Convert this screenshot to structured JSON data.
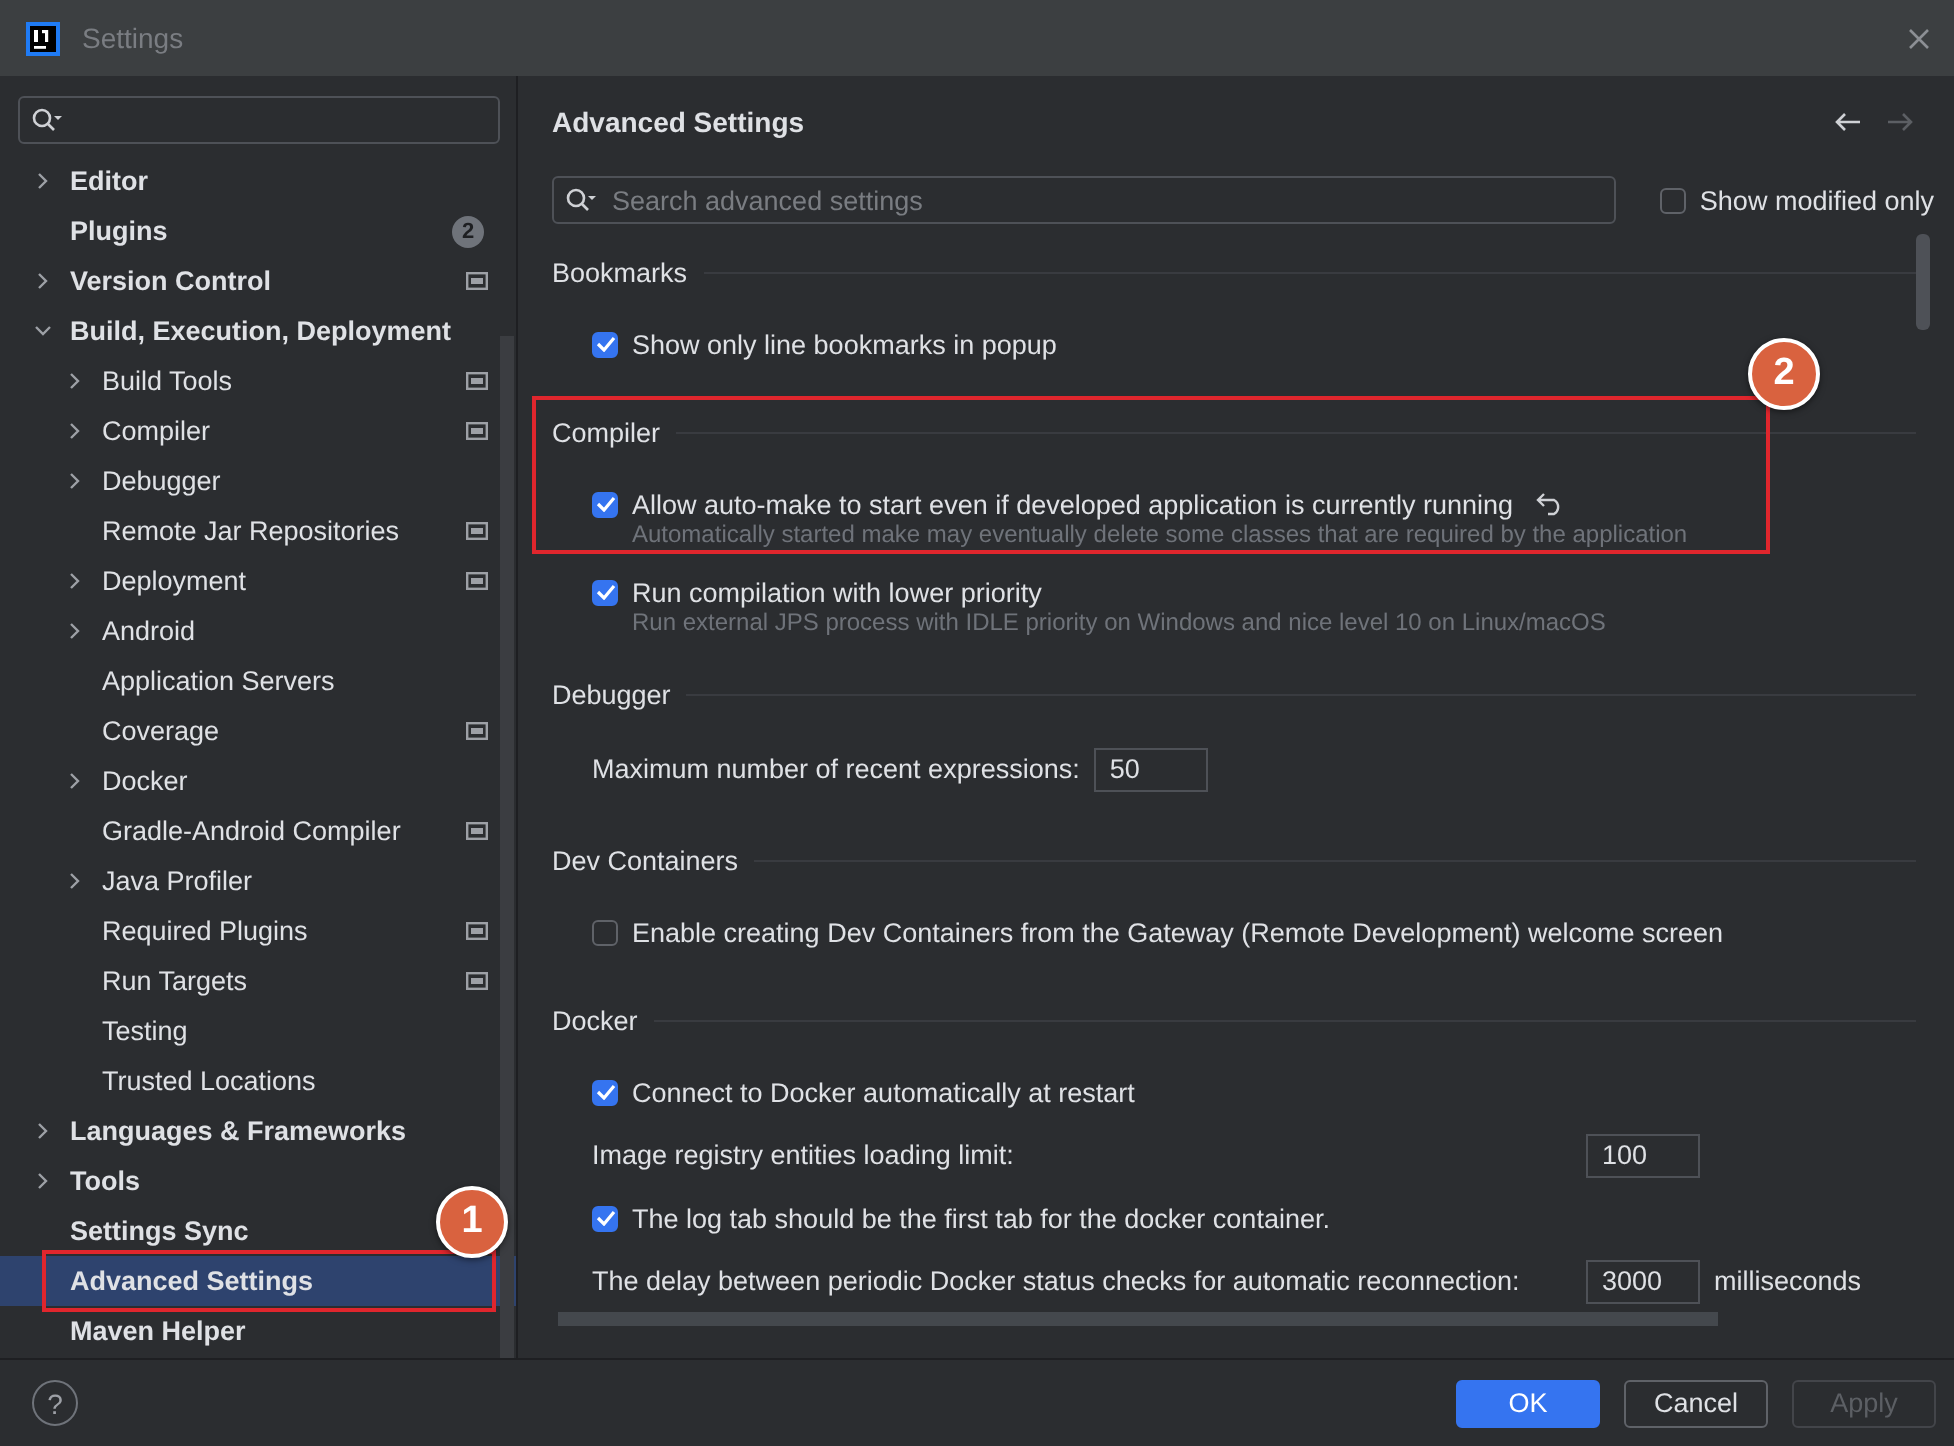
{
  "window": {
    "title": "Settings"
  },
  "sidebar": {
    "items": [
      {
        "label": "Editor",
        "kind": "folder",
        "expanded": false,
        "selected": false
      },
      {
        "label": "Plugins",
        "kind": "page",
        "selected": false,
        "badge": "2"
      },
      {
        "label": "Version Control",
        "kind": "folder",
        "expanded": false,
        "selected": false,
        "project_level": true
      },
      {
        "label": "Build, Execution, Deployment",
        "kind": "folder",
        "expanded": true,
        "selected": false,
        "children": [
          {
            "label": "Build Tools",
            "kind": "folder",
            "expanded": false,
            "selected": false,
            "project_level": true
          },
          {
            "label": "Compiler",
            "kind": "folder",
            "expanded": false,
            "selected": false,
            "project_level": true
          },
          {
            "label": "Debugger",
            "kind": "folder",
            "expanded": false,
            "selected": false
          },
          {
            "label": "Remote Jar Repositories",
            "kind": "page",
            "selected": false,
            "project_level": true
          },
          {
            "label": "Deployment",
            "kind": "folder",
            "expanded": false,
            "selected": false,
            "project_level": true
          },
          {
            "label": "Android",
            "kind": "folder",
            "expanded": false,
            "selected": false
          },
          {
            "label": "Application Servers",
            "kind": "page",
            "selected": false
          },
          {
            "label": "Coverage",
            "kind": "page",
            "selected": false,
            "project_level": true
          },
          {
            "label": "Docker",
            "kind": "folder",
            "expanded": false,
            "selected": false
          },
          {
            "label": "Gradle-Android Compiler",
            "kind": "page",
            "selected": false,
            "project_level": true
          },
          {
            "label": "Java Profiler",
            "kind": "folder",
            "expanded": false,
            "selected": false
          },
          {
            "label": "Required Plugins",
            "kind": "page",
            "selected": false,
            "project_level": true
          },
          {
            "label": "Run Targets",
            "kind": "page",
            "selected": false,
            "project_level": true
          },
          {
            "label": "Testing",
            "kind": "page",
            "selected": false
          },
          {
            "label": "Trusted Locations",
            "kind": "page",
            "selected": false
          }
        ]
      },
      {
        "label": "Languages & Frameworks",
        "kind": "folder",
        "expanded": false,
        "selected": false
      },
      {
        "label": "Tools",
        "kind": "folder",
        "expanded": false,
        "selected": false
      },
      {
        "label": "Settings Sync",
        "kind": "page",
        "selected": false
      },
      {
        "label": "Advanced Settings",
        "kind": "page",
        "selected": true,
        "callout": "1"
      },
      {
        "label": "Maven Helper",
        "kind": "page",
        "selected": false
      }
    ]
  },
  "content": {
    "title": "Advanced Settings",
    "search": {
      "placeholder": "Search advanced settings"
    },
    "show_modified_only": {
      "label": "Show modified only",
      "checked": false
    },
    "sections": [
      {
        "title": "Bookmarks",
        "items": [
          {
            "kind": "checkbox",
            "label": "Show only line bookmarks in popup",
            "checked": true
          }
        ]
      },
      {
        "title": "Compiler",
        "callout": "2",
        "items": [
          {
            "kind": "checkbox",
            "label": "Allow auto-make to start even if developed application is currently running",
            "checked": true,
            "modified": true,
            "description": "Automatically started make may eventually delete some classes that are required by the application"
          },
          {
            "kind": "checkbox",
            "label": "Run compilation with lower priority",
            "checked": true,
            "description": "Run external JPS process with IDLE priority on Windows and nice level 10 on Linux/macOS"
          }
        ]
      },
      {
        "title": "Debugger",
        "items": [
          {
            "kind": "number",
            "label": "Maximum number of recent expressions:",
            "value": "50"
          }
        ]
      },
      {
        "title": "Dev Containers",
        "items": [
          {
            "kind": "checkbox",
            "label": "Enable creating Dev Containers from the Gateway (Remote Development) welcome screen",
            "checked": false
          }
        ]
      },
      {
        "title": "Docker",
        "items": [
          {
            "kind": "checkbox",
            "label": "Connect to Docker automatically at restart",
            "checked": true
          },
          {
            "kind": "number",
            "label": "Image registry entities loading limit:",
            "value": "100",
            "wide": true
          },
          {
            "kind": "checkbox",
            "label": "The log tab should be the first tab for the docker container.",
            "checked": true
          },
          {
            "kind": "number",
            "label": "The delay between periodic Docker status checks for automatic reconnection:",
            "value": "3000",
            "suffix": "milliseconds",
            "wide": true
          }
        ]
      }
    ]
  },
  "help_button": "?",
  "buttons": [
    {
      "label": "OK",
      "kind": "primary",
      "disabled": false
    },
    {
      "label": "Cancel",
      "kind": "normal",
      "disabled": false
    },
    {
      "label": "Apply",
      "kind": "normal",
      "disabled": true
    }
  ]
}
